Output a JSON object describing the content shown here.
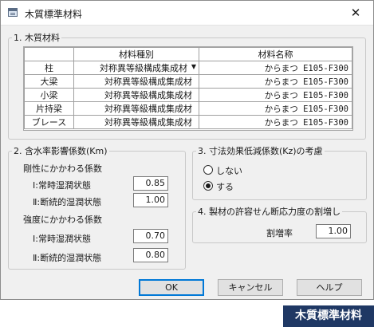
{
  "window": {
    "title": "木質標準材料",
    "close_label": "✕"
  },
  "section1": {
    "legend": "1. 木質材料",
    "columns": [
      "",
      "材料種別",
      "材料名称"
    ],
    "rows": [
      {
        "member": "柱",
        "type": "対称異等級構成集成材",
        "name": "からまつ E105-F300"
      },
      {
        "member": "大梁",
        "type": "対称異等級構成集成材",
        "name": "からまつ E105-F300"
      },
      {
        "member": "小梁",
        "type": "対称異等級構成集成材",
        "name": "からまつ E105-F300"
      },
      {
        "member": "片持梁",
        "type": "対称異等級構成集成材",
        "name": "からまつ E105-F300"
      },
      {
        "member": "ブレース",
        "type": "対称異等級構成集成材",
        "name": "からまつ E105-F300"
      }
    ]
  },
  "section2": {
    "legend": "2. 含水率影響係数(Km)",
    "stiffness_label": "剛性にかかわる係数",
    "stiffness": [
      {
        "label": "Ⅰ:常時湿潤状態",
        "value": "0.85"
      },
      {
        "label": "Ⅱ:断続的湿潤状態",
        "value": "1.00"
      }
    ],
    "strength_label": "強度にかかわる係数",
    "strength": [
      {
        "label": "Ⅰ:常時湿潤状態",
        "value": "0.70"
      },
      {
        "label": "Ⅱ:断続的湿潤状態",
        "value": "0.80"
      }
    ]
  },
  "section3": {
    "legend": "3. 寸法効果低減係数(Kz)の考慮",
    "options": [
      {
        "label": "しない",
        "checked": false
      },
      {
        "label": "する",
        "checked": true
      }
    ]
  },
  "section4": {
    "legend": "4. 製材の許容せん断応力度の割増し",
    "ratio_label": "割増率",
    "ratio_value": "1.00"
  },
  "buttons": {
    "ok": "OK",
    "cancel": "キャンセル",
    "help": "ヘルプ"
  },
  "caption": "木質標準材料"
}
